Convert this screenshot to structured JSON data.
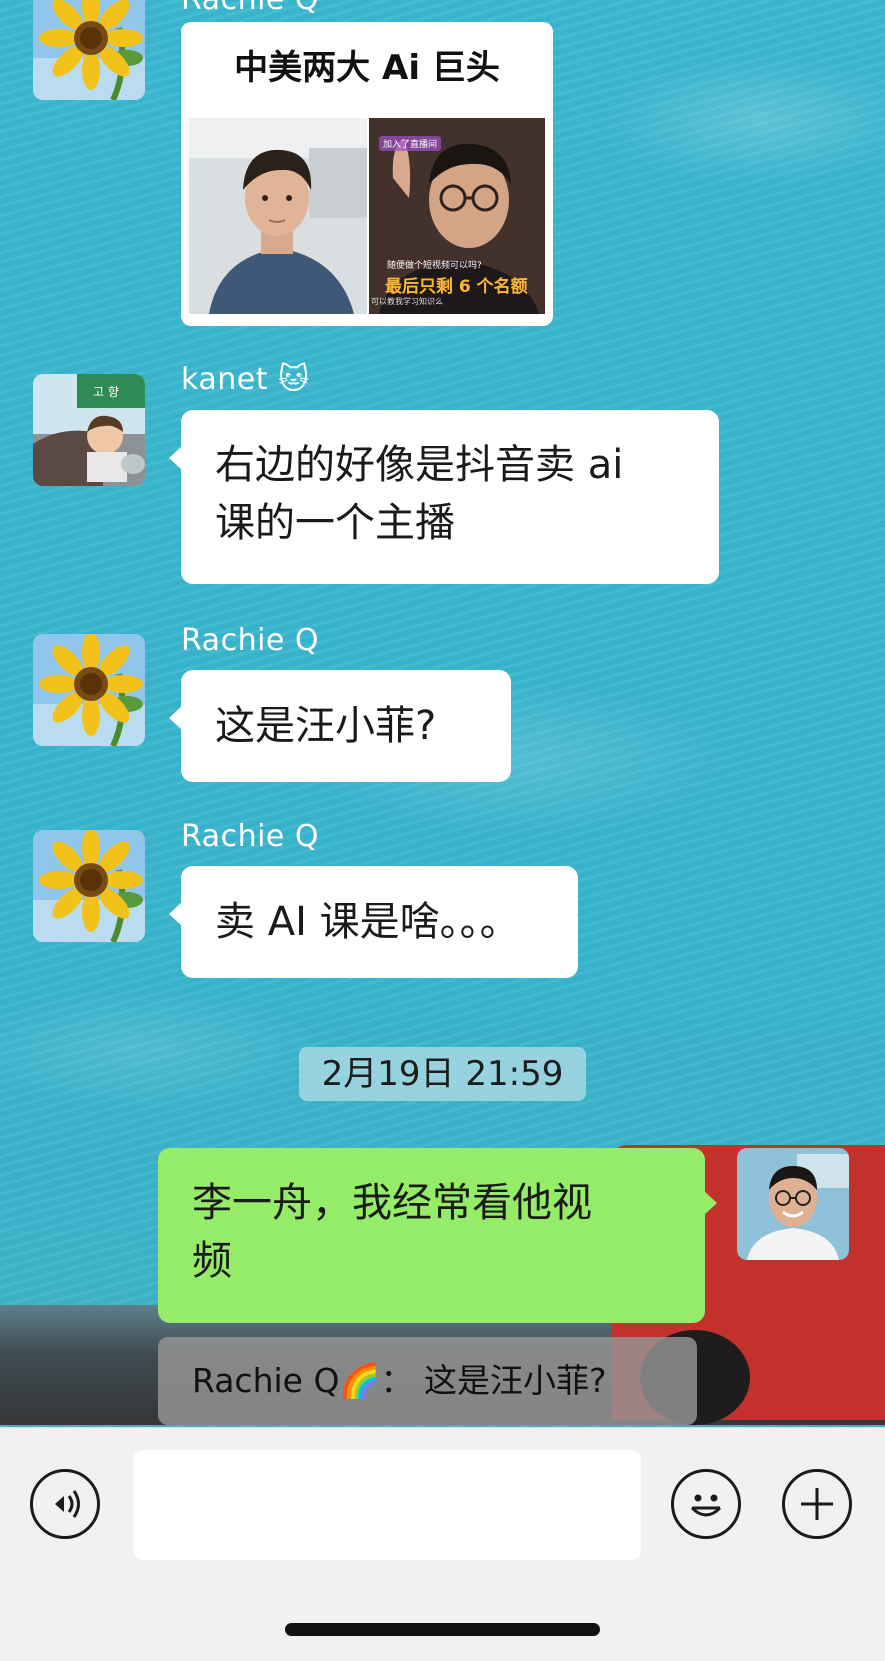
{
  "messages": {
    "top_sender_partial": "Rachie Q",
    "image_card_title": "中美两大 Ai 巨头",
    "image_overlay_top": "加入了直播间",
    "image_overlay_mid": "随便做个短视频可以吗?",
    "image_overlay_big": "最后只剩 6 个名额",
    "image_overlay_bottom": "可以教我学习知识么",
    "kanet_name": "kanet 🐱",
    "kanet_message_line1": "右边的好像是抖音卖 ai",
    "kanet_message_line2": "课的一个主播",
    "rachie_name_1": "Rachie Q",
    "rachie_message_1": "这是汪小菲?",
    "rachie_name_2": "Rachie Q",
    "rachie_message_2": "卖 AI 课是啥。。。",
    "timestamp": "2月19日 21:59",
    "me_message_line1": "李一舟，我经常看他视",
    "me_message_line2": "频",
    "quote_text": "Rachie Q🌈：  这是汪小菲?"
  },
  "input": {
    "placeholder": ""
  },
  "icons": {
    "voice": "voice-icon",
    "emoji": "emoji-icon",
    "plus": "plus-icon"
  },
  "colors": {
    "chat_background": "#39b6cf",
    "incoming_bubble": "#ffffff",
    "outgoing_bubble": "#95ec69",
    "input_bar": "#f1f1f1"
  }
}
